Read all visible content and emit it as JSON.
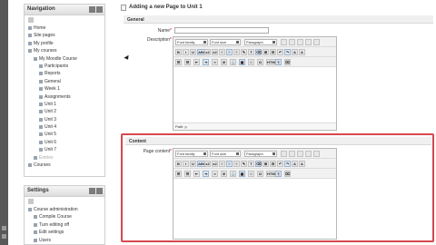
{
  "navigation": {
    "title": "Navigation",
    "items": [
      {
        "label": "Home",
        "indent": 0
      },
      {
        "label": "Site pages",
        "indent": 0
      },
      {
        "label": "My profile",
        "indent": 0
      },
      {
        "label": "My courses",
        "indent": 0
      },
      {
        "label": "My Moodle Course",
        "indent": 1
      },
      {
        "label": "Participants",
        "indent": 2
      },
      {
        "label": "Reports",
        "indent": 2
      },
      {
        "label": "General",
        "indent": 2
      },
      {
        "label": "Week 1",
        "indent": 2
      },
      {
        "label": "Assignments",
        "indent": 2
      },
      {
        "label": "Unit 1",
        "indent": 2
      },
      {
        "label": "Unit 2",
        "indent": 2
      },
      {
        "label": "Unit 3",
        "indent": 2
      },
      {
        "label": "Unit 4",
        "indent": 2
      },
      {
        "label": "Unit 5",
        "indent": 2
      },
      {
        "label": "Unit 6",
        "indent": 2
      },
      {
        "label": "Unit 7",
        "indent": 2
      },
      {
        "label": "Entries",
        "indent": 1
      },
      {
        "label": "Courses",
        "indent": 0
      }
    ]
  },
  "settings": {
    "title": "Settings",
    "items": [
      {
        "label": "Course administration",
        "indent": 0
      },
      {
        "label": "Compile Course",
        "indent": 1
      },
      {
        "label": "Turn editing off",
        "indent": 1
      },
      {
        "label": "Edit settings",
        "indent": 1
      },
      {
        "label": "Users",
        "indent": 1
      }
    ]
  },
  "page": {
    "title": "Adding a new Page to Unit 1",
    "general_section": "General",
    "name_label": "Name",
    "description_label": "Description",
    "content_section": "Content",
    "page_content_label": "Page content",
    "required_mark": "*"
  },
  "editor": {
    "font_family": "Font family",
    "font_size": "Font size",
    "paragraph": "Paragraph",
    "path_label": "Path: p",
    "buttons_row2": [
      "B",
      "I",
      "U",
      "ABC",
      "x2",
      "x2",
      "≡",
      "≡",
      "≡",
      "✎",
      "T",
      "⌫",
      "⊞",
      "⊟",
      "↶",
      "↷",
      "A",
      "A"
    ],
    "buttons_row3": [
      "☰",
      "☰",
      "⇤",
      "⇥",
      "∞",
      "⊘",
      "⚓",
      "▦",
      "☺",
      "Ω",
      "HTML",
      "¶",
      "⌧"
    ]
  }
}
